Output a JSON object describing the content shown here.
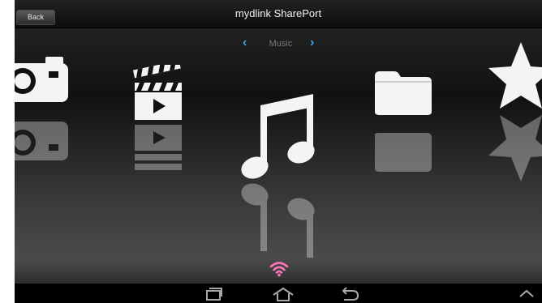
{
  "header": {
    "back_label": "Back",
    "title": "mydlink SharePort"
  },
  "category_nav": {
    "current": "Music",
    "prev_icon": "chevron-left-icon",
    "next_icon": "chevron-right-icon"
  },
  "carousel": {
    "items": [
      {
        "icon": "camera-icon"
      },
      {
        "icon": "video-clapperboard-icon"
      },
      {
        "icon": "music-note-icon",
        "selected": true
      },
      {
        "icon": "folder-icon"
      },
      {
        "icon": "star-icon"
      }
    ]
  },
  "status": {
    "icon": "wifi-icon",
    "color": "#ff77bb"
  },
  "system_bar": {
    "icons": [
      "recent-apps-icon",
      "home-icon",
      "back-arrow-icon",
      "chevron-up-icon"
    ]
  },
  "colors": {
    "accent": "#3ea6e6",
    "wifi": "#ff77bb"
  }
}
